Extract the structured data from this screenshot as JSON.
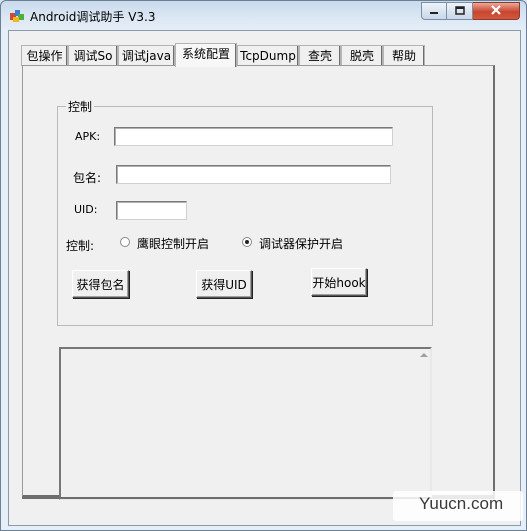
{
  "window": {
    "title": "Android调试助手 V3.3"
  },
  "tabs": [
    {
      "label": "包操作"
    },
    {
      "label": "调试So"
    },
    {
      "label": "调试java"
    },
    {
      "label": "系统配置"
    },
    {
      "label": "TcpDump"
    },
    {
      "label": "查壳"
    },
    {
      "label": "脱壳"
    },
    {
      "label": "帮助"
    }
  ],
  "active_tab": "系统配置",
  "control_group": {
    "legend": "控制",
    "apk_label": "APK:",
    "apk_value": "",
    "package_label": "包名:",
    "package_value": "",
    "uid_label": "UID:",
    "uid_value": "",
    "control_label": "控制:",
    "radio_options": [
      {
        "label": "鹰眼控制开启",
        "checked": false
      },
      {
        "label": "调试器保护开启",
        "checked": true
      }
    ],
    "buttons": {
      "get_package": "获得包名",
      "get_uid": "获得UID",
      "start_hook": "开始hook"
    }
  },
  "log_text": "",
  "watermark": "Yuucn.com",
  "colors": {
    "close_button": "#c8452e",
    "panel_bg": "#f0f0f0",
    "titlebar_bg": "#dde8f4"
  }
}
